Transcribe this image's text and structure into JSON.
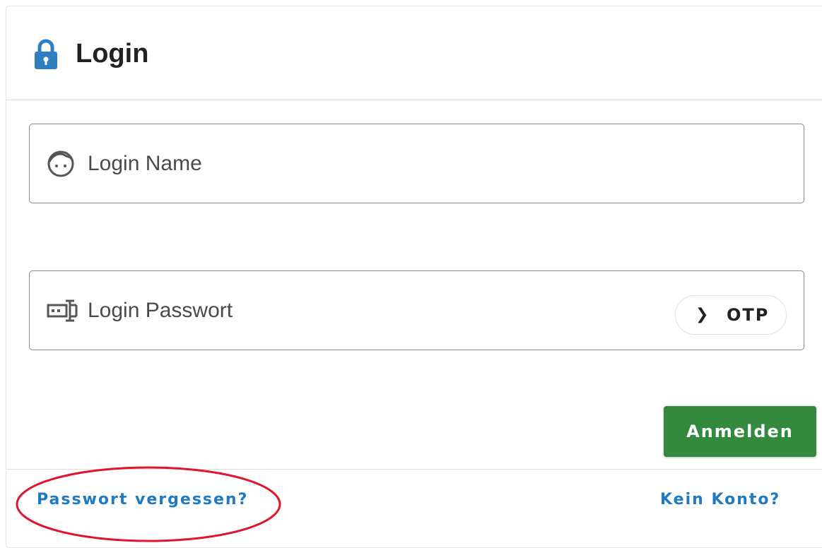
{
  "header": {
    "title": "Login",
    "icon": "lock-icon",
    "icon_color": "#2d7fc1"
  },
  "form": {
    "login_name_placeholder": "Login Name",
    "login_name_icon": "face-icon",
    "password_placeholder": "Login Passwort",
    "password_icon": "password-field-icon",
    "otp_button_label": "OTP",
    "otp_icon": "chevron-right-icon",
    "submit_label": "Anmelden",
    "submit_color": "#338a3e"
  },
  "footer": {
    "forgot_password_label": "Passwort vergessen?",
    "no_account_label": "Kein Konto?",
    "link_color": "#1f7ac2"
  },
  "annotation": {
    "highlight_color": "#e0142a"
  }
}
